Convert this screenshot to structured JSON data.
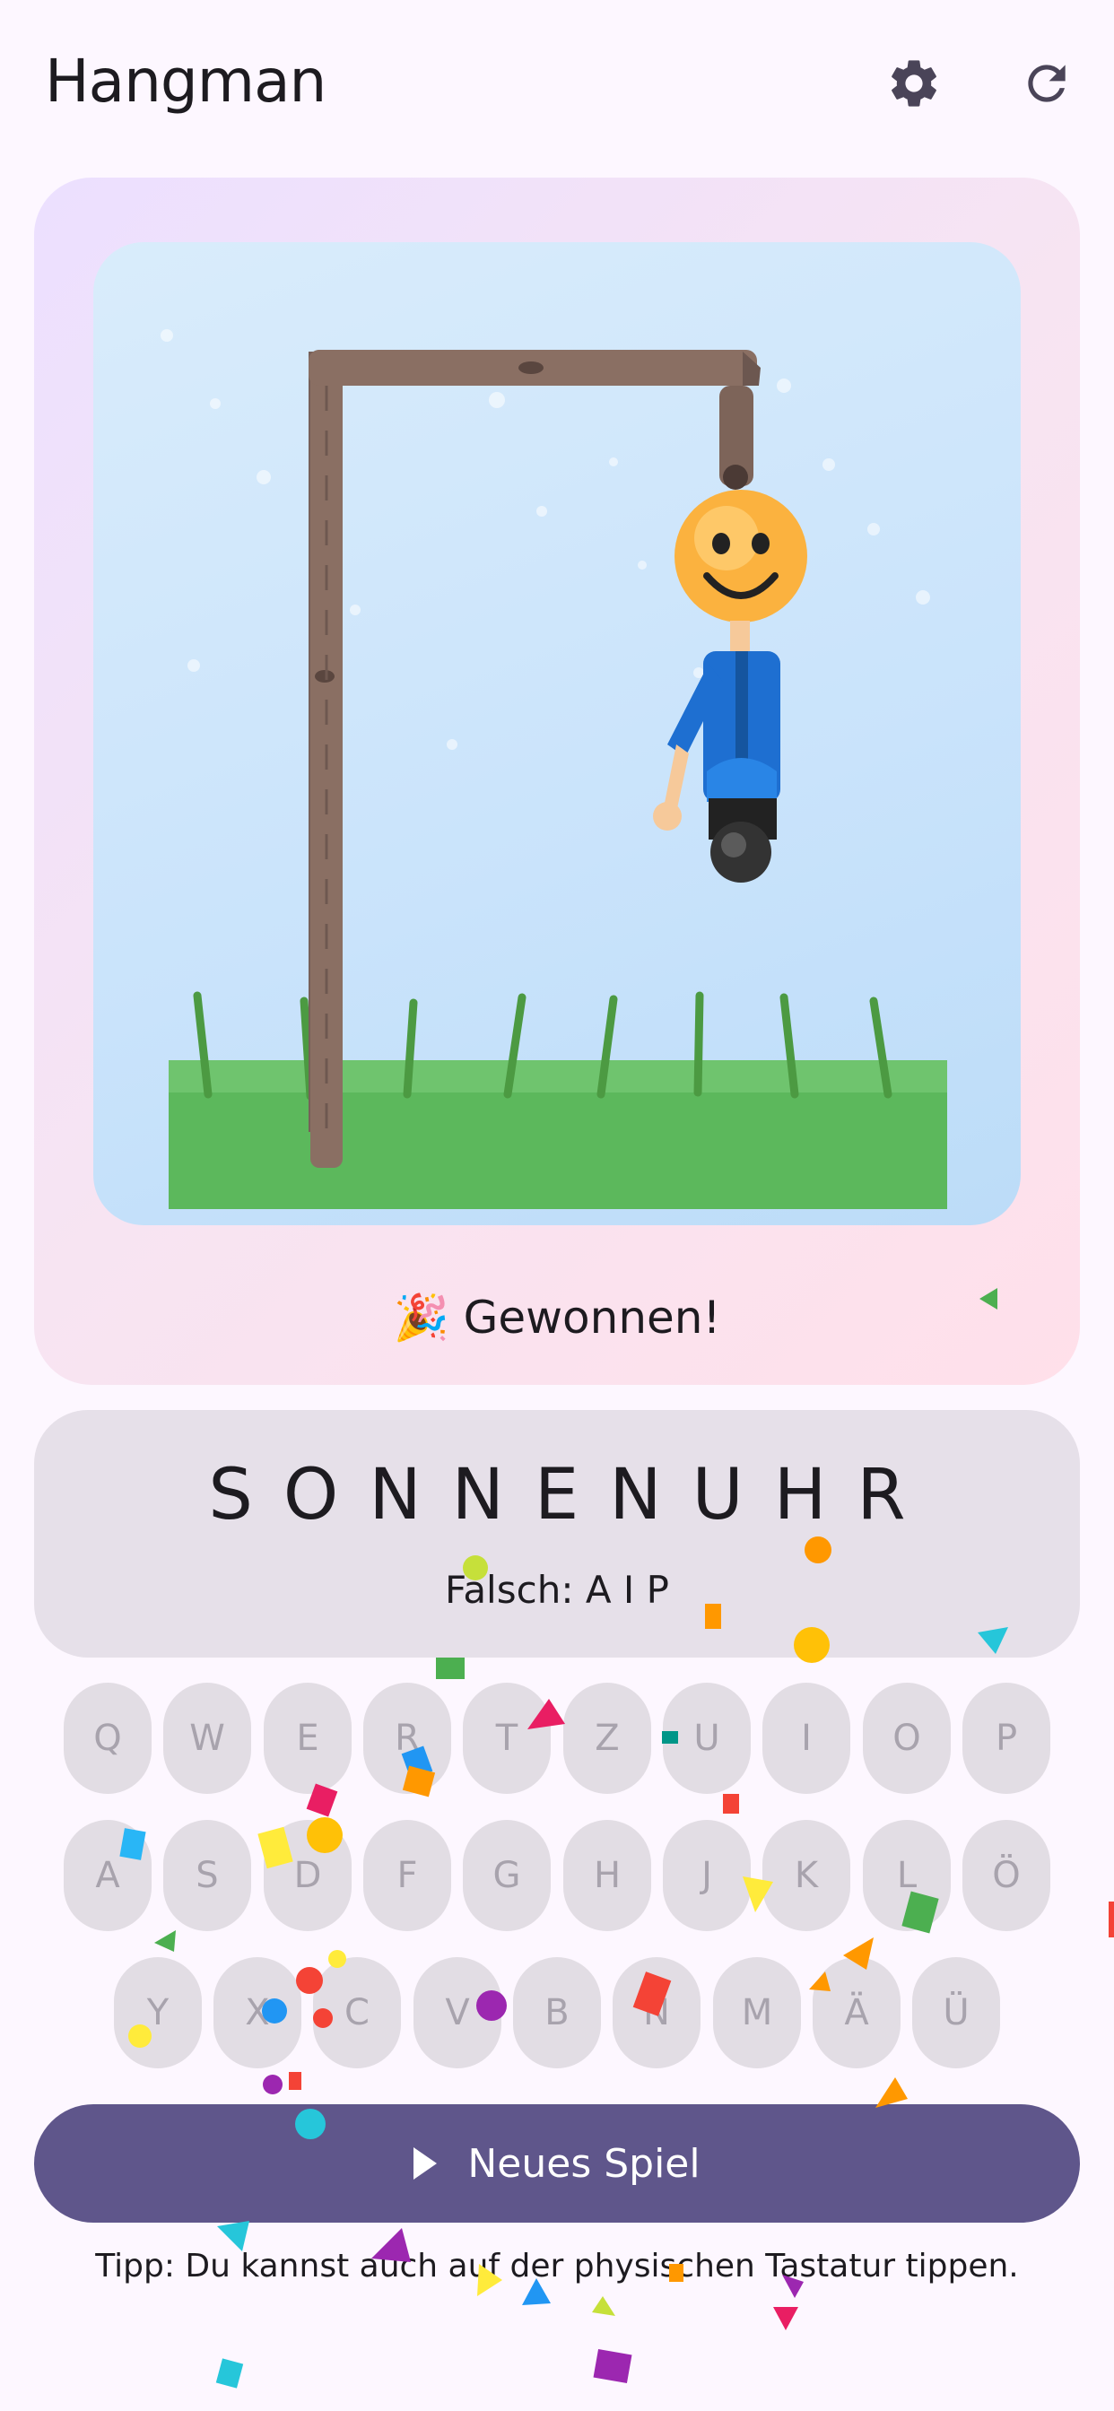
{
  "app_bar": {
    "title": "Hangman",
    "settings_icon": "gear-icon",
    "restart_icon": "refresh-icon"
  },
  "game": {
    "status_emoji": "🎉",
    "status_text": "Gewonnen!",
    "word": "SONNENUHR",
    "wrong_label": "Falsch: A I P"
  },
  "keyboard": {
    "row1": [
      "Q",
      "W",
      "E",
      "R",
      "T",
      "Z",
      "U",
      "I",
      "O",
      "P"
    ],
    "row2": [
      "A",
      "S",
      "D",
      "F",
      "G",
      "H",
      "J",
      "K",
      "L",
      "Ö"
    ],
    "row3": [
      "Y",
      "X",
      "C",
      "V",
      "B",
      "N",
      "M",
      "Ä",
      "Ü"
    ]
  },
  "new_game_label": "Neues Spiel",
  "tip_text": "Tipp: Du kannst auch auf der physischen Tastatur tippen.",
  "colors": {
    "primary": "#5f568b",
    "background": "#fdf7ff",
    "key_bg": "#e2dde4",
    "grass": "#5cb85c",
    "wood": "#8a6f63",
    "shirt": "#1e6fd1"
  }
}
